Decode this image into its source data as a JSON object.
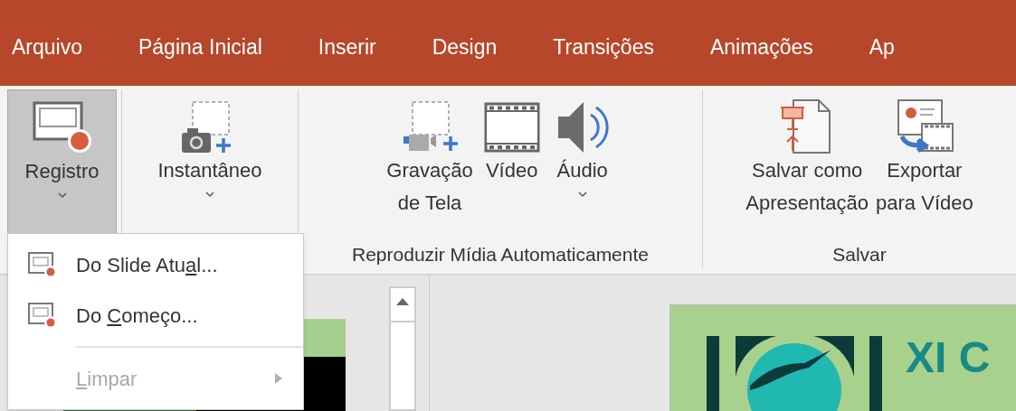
{
  "menu_tabs": [
    {
      "label": "Arquivo"
    },
    {
      "label": "Página Inicial"
    },
    {
      "label": "Inserir"
    },
    {
      "label": "Design"
    },
    {
      "label": "Transições"
    },
    {
      "label": "Animações"
    },
    {
      "label": "Ap"
    }
  ],
  "ribbon_groups": [
    {
      "buttons": [
        {
          "kind": "record",
          "lines": [
            "Registro"
          ],
          "dropdown": true,
          "pressed": true
        }
      ]
    },
    {
      "buttons": [
        {
          "kind": "snapshot",
          "lines": [
            "Instantâneo"
          ],
          "dropdown": true,
          "pressed": false
        }
      ]
    },
    {
      "label": "Reproduzir Mídia Automaticamente",
      "buttons": [
        {
          "kind": "screen-recording",
          "lines": [
            "Gravação",
            "de Tela"
          ],
          "dropdown": false,
          "pressed": false
        },
        {
          "kind": "video",
          "lines": [
            "Vídeo"
          ],
          "dropdown": false,
          "pressed": false
        },
        {
          "kind": "audio",
          "lines": [
            "Áudio"
          ],
          "dropdown": true,
          "pressed": false
        }
      ]
    },
    {
      "label": "Salvar",
      "buttons": [
        {
          "kind": "save-show",
          "lines": [
            "Salvar como",
            "Apresentação"
          ],
          "dropdown": false,
          "pressed": false
        },
        {
          "kind": "export-video",
          "lines": [
            "Exportar",
            "para Vídeo"
          ],
          "dropdown": false,
          "pressed": false
        }
      ]
    }
  ],
  "dropdown_menu": [
    {
      "kind": "command",
      "disabled": false,
      "parts": [
        {
          "text": "Do Slide Atu",
          "underline": false
        },
        {
          "text": "a",
          "underline": true
        },
        {
          "text": "l...",
          "underline": false
        }
      ]
    },
    {
      "kind": "command",
      "disabled": false,
      "parts": [
        {
          "text": "Do ",
          "underline": false
        },
        {
          "text": "C",
          "underline": true
        },
        {
          "text": "omeço...",
          "underline": false
        }
      ]
    },
    {
      "kind": "separator"
    },
    {
      "kind": "submenu",
      "disabled": true,
      "parts": [
        {
          "text": "L",
          "underline": true
        },
        {
          "text": "impar",
          "underline": false
        }
      ]
    }
  ],
  "slide": {
    "title": "XI C"
  }
}
